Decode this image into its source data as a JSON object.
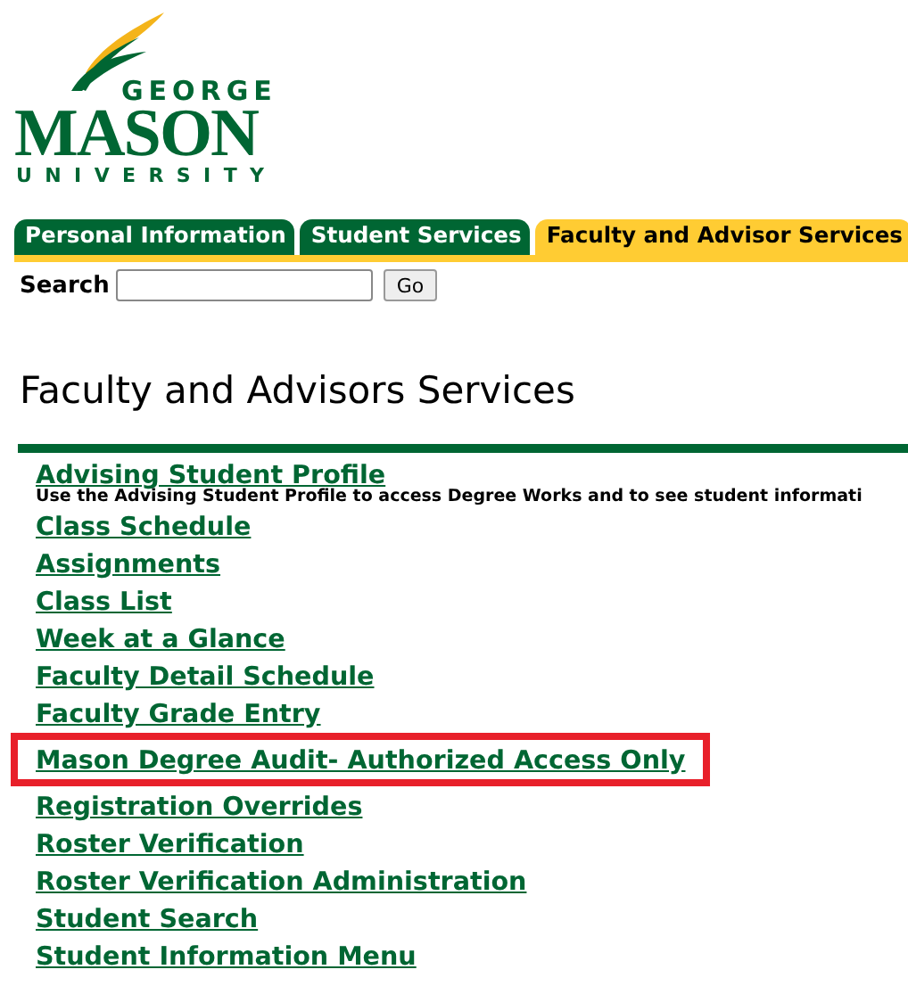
{
  "logo": {
    "line_1": "GEORGE",
    "line_2": "MASON",
    "line_3": "UNIVERSITY"
  },
  "tabs": [
    {
      "label": "Personal Information",
      "selected": false
    },
    {
      "label": "Student Services",
      "selected": false
    },
    {
      "label": "Faculty and Advisor Services",
      "selected": true
    }
  ],
  "search": {
    "label": "Search",
    "button": "Go"
  },
  "heading": "Faculty and Advisors Services",
  "links": [
    {
      "label": "Advising Student Profile",
      "description": "Use the Advising Student Profile to access Degree Works and to see student informati",
      "highlighted": false
    },
    {
      "label": "Class Schedule",
      "highlighted": false
    },
    {
      "label": "Assignments",
      "highlighted": false
    },
    {
      "label": "Class List",
      "highlighted": false
    },
    {
      "label": "Week at a Glance",
      "highlighted": false
    },
    {
      "label": "Faculty Detail Schedule",
      "highlighted": false
    },
    {
      "label": "Faculty Grade Entry",
      "highlighted": false
    },
    {
      "label": "Mason Degree Audit- Authorized Access Only",
      "highlighted": true
    },
    {
      "label": "Registration Overrides",
      "highlighted": false
    },
    {
      "label": "Roster Verification",
      "highlighted": false
    },
    {
      "label": "Roster Verification Administration",
      "highlighted": false
    },
    {
      "label": "Student Search",
      "highlighted": false
    },
    {
      "label": "Student Information Menu",
      "highlighted": false
    }
  ]
}
